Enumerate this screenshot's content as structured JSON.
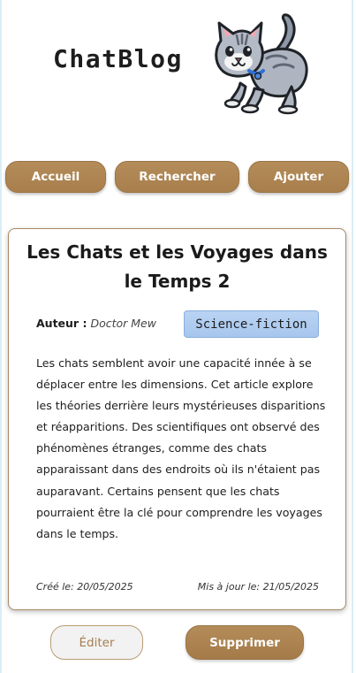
{
  "header": {
    "logo_text": "ChatBlog",
    "mascot_icon": "cat-mascot-icon"
  },
  "nav": {
    "items": [
      {
        "label": "Accueil"
      },
      {
        "label": "Rechercher"
      },
      {
        "label": "Ajouter"
      }
    ]
  },
  "article": {
    "title": "Les Chats et les Voyages dans le Temps 2",
    "author_label": "Auteur :",
    "author_name": "Doctor Mew",
    "genre": "Science-fiction",
    "body": "Les chats semblent avoir une capacité innée à se déplacer entre les dimensions. Cet article explore les théories derrière leurs mystérieuses disparitions et réapparitions. Des scientifiques ont observé des phénomènes étranges, comme des chats apparaissant dans des endroits où ils n'étaient pas auparavant. Certains pensent que les chats pourraient être la clé pour comprendre les voyages dans le temps.",
    "created": "Créé le: 20/05/2025",
    "updated": "Mis à jour le: 21/05/2025"
  },
  "actions": {
    "edit_label": "Éditer",
    "delete_label": "Supprimer"
  },
  "colors": {
    "accent": "#ad8452",
    "badge": "#b0cbf0",
    "border": "#a88a66"
  }
}
